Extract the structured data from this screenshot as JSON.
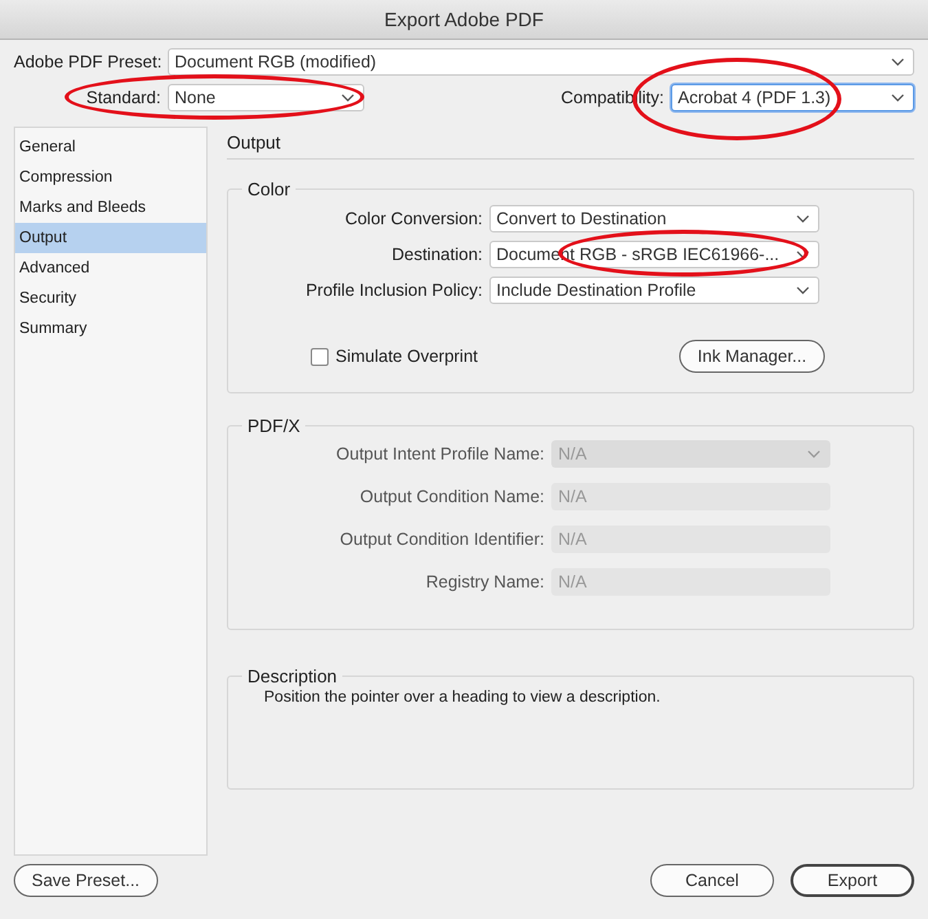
{
  "window": {
    "title": "Export Adobe PDF"
  },
  "preset": {
    "label": "Adobe PDF Preset:",
    "value": "Document RGB (modified)"
  },
  "standard": {
    "label": "Standard:",
    "value": "None",
    "circled": true
  },
  "compatibility": {
    "label": "Compatibility:",
    "value": "Acrobat 4 (PDF 1.3)",
    "circled": true,
    "focused": true
  },
  "sidebar": {
    "items": [
      {
        "label": "General",
        "selected": false
      },
      {
        "label": "Compression",
        "selected": false
      },
      {
        "label": "Marks and Bleeds",
        "selected": false
      },
      {
        "label": "Output",
        "selected": true
      },
      {
        "label": "Advanced",
        "selected": false
      },
      {
        "label": "Security",
        "selected": false
      },
      {
        "label": "Summary",
        "selected": false
      }
    ]
  },
  "section_title": "Output",
  "color_group": {
    "title": "Color",
    "fields": [
      {
        "label": "Color Conversion:",
        "value": "Convert to Destination"
      },
      {
        "label": "Destination:",
        "value": "Document RGB - sRGB IEC61966-...",
        "circled": true
      },
      {
        "label": "Profile Inclusion Policy:",
        "value": "Include Destination Profile"
      }
    ],
    "simulate_overprint": {
      "label": "Simulate Overprint",
      "checked": false
    },
    "ink_manager_button": "Ink Manager..."
  },
  "pdfx_group": {
    "title": "PDF/X",
    "fields": [
      {
        "label": "Output Intent Profile Name:",
        "value": "N/A",
        "kind": "dropdown",
        "disabled": true
      },
      {
        "label": "Output Condition Name:",
        "value": "N/A",
        "kind": "text",
        "disabled": true
      },
      {
        "label": "Output Condition Identifier:",
        "value": "N/A",
        "kind": "text",
        "disabled": true
      },
      {
        "label": "Registry Name:",
        "value": "N/A",
        "kind": "text",
        "disabled": true
      }
    ]
  },
  "description": {
    "title": "Description",
    "text": "Position the pointer over a heading to view a description."
  },
  "buttons": {
    "left": [
      "Save Preset..."
    ],
    "right": [
      {
        "label": "Cancel",
        "default": false
      },
      {
        "label": "Export",
        "default": true
      }
    ]
  }
}
